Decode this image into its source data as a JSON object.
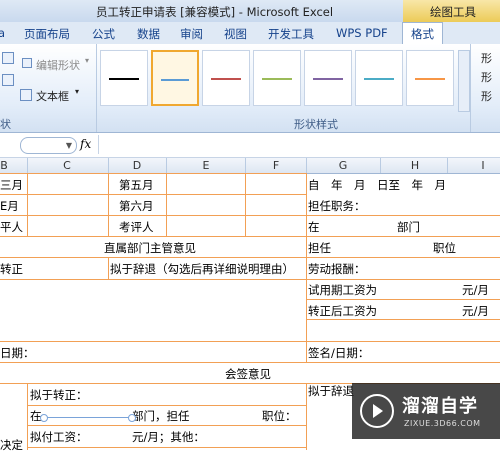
{
  "window": {
    "title": "员工转正申请表 [兼容模式] - Microsoft Excel",
    "contextual_tab_group": "绘图工具"
  },
  "tabs": [
    "页面布局",
    "公式",
    "数据",
    "审阅",
    "视图",
    "开发工具",
    "WPS PDF",
    "格式"
  ],
  "active_tab": "格式",
  "ribbon": {
    "edit_shape": "编辑形状",
    "text_box": "文本框",
    "left_group_label": "状",
    "shape_styles_label": "形状样式",
    "right_items": [
      "形",
      "形",
      "形"
    ],
    "style_swatches": [
      {
        "color": "#000000",
        "selected": false
      },
      {
        "color": "#5b9bd5",
        "selected": true
      },
      {
        "color": "#c0504d",
        "selected": false
      },
      {
        "color": "#9bbb59",
        "selected": false
      },
      {
        "color": "#8064a2",
        "selected": false
      },
      {
        "color": "#4bacc6",
        "selected": false
      },
      {
        "color": "#f79646",
        "selected": false
      }
    ]
  },
  "formula_bar": {
    "fx": "fx",
    "value": ""
  },
  "columns": [
    "B",
    "C",
    "D",
    "E",
    "F",
    "G",
    "H",
    "I"
  ],
  "sheet": {
    "r1": {
      "b": "三月",
      "d": "第五月",
      "g": "自　年　月　日至　年　月"
    },
    "r2": {
      "b": "E月",
      "d": "第六月",
      "g": "担任职务："
    },
    "r3": {
      "b": "平人",
      "d": "考评人",
      "g": "在",
      "h": "部门"
    },
    "r4": {
      "mid": "直属部门主管意见",
      "g": "担任",
      "h": "职位"
    },
    "r5": {
      "b": "转正",
      "d": "拟于辞退（勾选后再详细说明理由）",
      "g": "劳动报酬："
    },
    "r6": {
      "g": "试用期工资为",
      "i": "元/月"
    },
    "r7": {
      "g": "转正后工资为",
      "i": "元/月"
    },
    "r8": {
      "b": "日期：",
      "g": "签名/日期："
    },
    "r9": {
      "mid": "会签意见"
    },
    "r10": {
      "b": "拟于转正：",
      "g": "拟于辞退"
    },
    "r11": {
      "b": "在",
      "d": "部门，担任",
      "f": "职位："
    },
    "r12": {
      "b": "拟付工资：",
      "d": "元/月；其他："
    },
    "r13": {
      "a": "决定"
    }
  },
  "watermark": {
    "brand": "溜溜自学",
    "site": "ZIXUE.3D66.COM"
  }
}
